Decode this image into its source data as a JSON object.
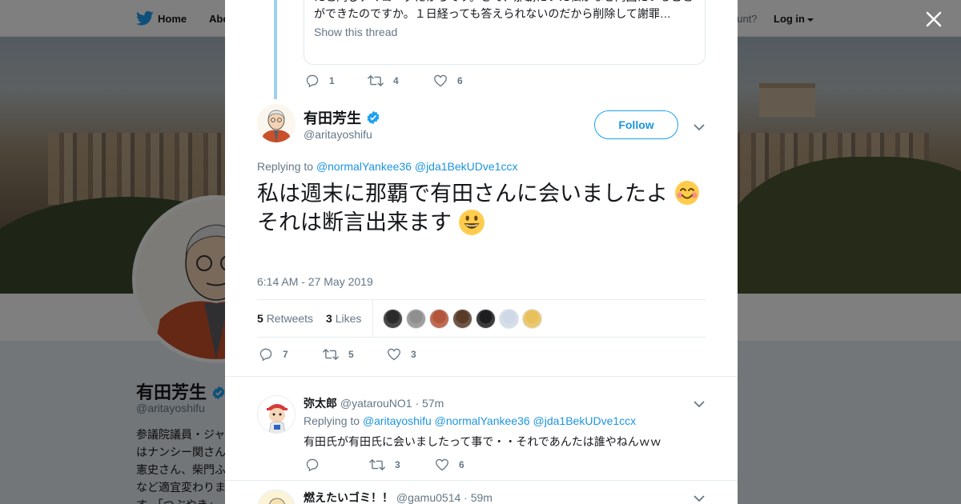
{
  "nav": {
    "home_label": "Home",
    "about_label": "Abo",
    "account_text": "ccount?",
    "login_label": "Log in"
  },
  "background_profile": {
    "name": "有田芳生",
    "handle": "@aritayoshifu",
    "bio": "参議院議員・ジャ はナンシー関さん 憲史さん、柴門ふ など適宜変わりま す。「つぶやき」"
  },
  "quoted_tweet": {
    "text": "たと同じデマゴーグだからです。さて、那覇にいた私がなぜ両国にいることができたのですか。１日経っても答えられないのだから削除して謝罪…",
    "show_thread": "Show this thread",
    "replies": "1",
    "retweets": "4",
    "likes": "6"
  },
  "main_tweet": {
    "name": "有田芳生",
    "handle": "@aritayoshifu",
    "follow_label": "Follow",
    "replying_label": "Replying to",
    "mention1": "@normalYankee36",
    "mention2": "@jda1BekUDve1ccx",
    "line1": "私は週末に那覇で有田さんに会いましたよ",
    "line2": "それは断言出来ます",
    "time": "6:14 AM - 27 May 2019",
    "retweets_count": "5",
    "retweets_label": "Retweets",
    "likes_count": "3",
    "likes_label": "Likes",
    "replies": "7",
    "retweets": "5",
    "likes": "3",
    "liker_colors": [
      "#2b2b2b",
      "#8f8f8f",
      "#b4553c",
      "#5a3c2a",
      "#1e1e1e",
      "#cfd8e6",
      "#e8c15c"
    ]
  },
  "replies": [
    {
      "name": "弥太郎",
      "handle": "@yatarouNO1",
      "time": "· 57m",
      "replying_label": "Replying to",
      "mentions": "@aritayoshifu @normalYankee36 @jda1BekUDve1ccx",
      "text": "有田氏が有田氏に会いましたって事で・・それであんたは誰やねんｗｗ",
      "replies": "",
      "retweets": "3",
      "likes": "6"
    },
    {
      "name": "燃えたいゴミ！！",
      "handle": "@gamu0514",
      "time": "· 59m"
    }
  ],
  "colors": {
    "accent": "#1da1f2",
    "link": "#1b95e0",
    "muted": "#657786",
    "thread_line": "#9fd0f0"
  },
  "icons": [
    "twitter-bird-icon",
    "close-icon",
    "reply-icon",
    "retweet-icon",
    "like-icon",
    "verified-icon",
    "chevron-down-icon",
    "smiling-face-with-hearts-icon",
    "grinning-face-icon"
  ]
}
